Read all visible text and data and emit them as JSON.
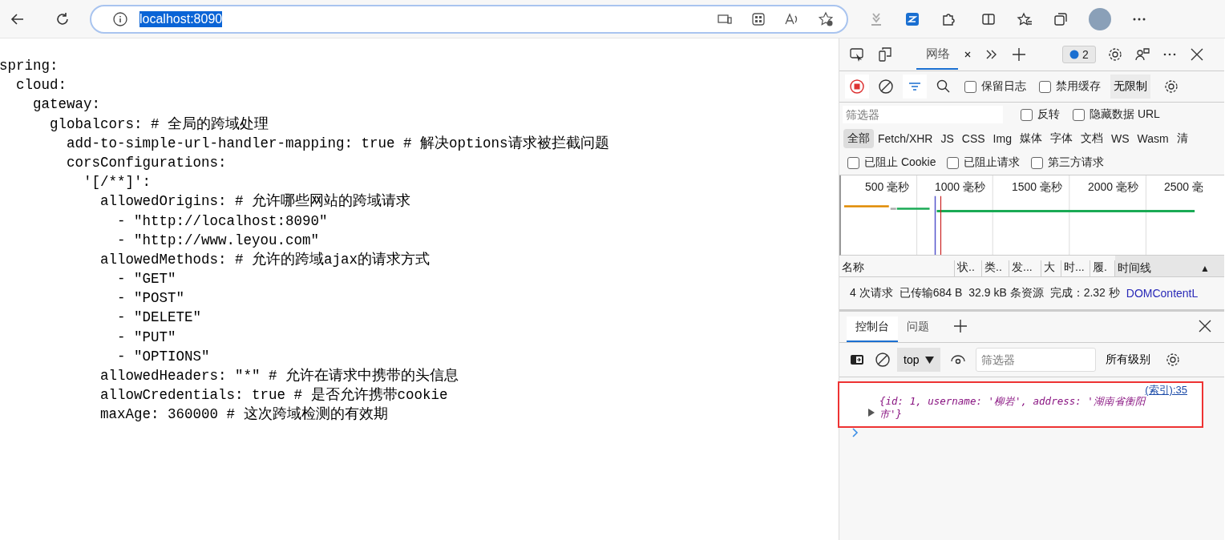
{
  "browser": {
    "address": "localhost:8090"
  },
  "code": [
    {
      "text": "spring:",
      "children": [
        {
          "text": "cloud:",
          "children": [
            {
              "text": "gateway:",
              "children": [
                {
                  "text": "globalcors: # 全局的跨域处理",
                  "children": [
                    {
                      "text": "add-to-simple-url-handler-mapping: true # 解决options请求被拦截问题"
                    },
                    {
                      "text": "corsConfigurations:",
                      "children": [
                        {
                          "text": "'[/**]':",
                          "children": [
                            {
                              "text": "allowedOrigins: # 允许哪些网站的跨域请求",
                              "children": [
                                {
                                  "text": "- \"http://localhost:8090\""
                                },
                                {
                                  "text": "- \"http://www.leyou.com\""
                                }
                              ]
                            },
                            {
                              "text": "allowedMethods: # 允许的跨域ajax的请求方式",
                              "children": [
                                {
                                  "text": "- \"GET\""
                                },
                                {
                                  "text": "- \"POST\""
                                },
                                {
                                  "text": "- \"DELETE\""
                                },
                                {
                                  "text": "- \"PUT\""
                                },
                                {
                                  "text": "- \"OPTIONS\""
                                }
                              ]
                            },
                            {
                              "text": "allowedHeaders: \"*\" # 允许在请求中携带的头信息"
                            },
                            {
                              "text": "allowCredentials: true # 是否允许携带cookie"
                            },
                            {
                              "text": "maxAge: 360000 # 这次跨域检测的有效期"
                            }
                          ]
                        }
                      ]
                    }
                  ]
                }
              ]
            }
          ]
        }
      ]
    }
  ],
  "devtools": {
    "tabs": [
      {
        "label": "网络",
        "selected": true
      }
    ],
    "issues_badge": "2",
    "network_toolbar": {
      "checkboxes": [
        {
          "label": "保留日志",
          "checked": false
        },
        {
          "label": "禁用缓存",
          "checked": false
        }
      ],
      "throttle": "无限制"
    },
    "filter": {
      "placeholder": "筛选器",
      "checkboxes": [
        {
          "label": "反转",
          "checked": false
        },
        {
          "label": "隐藏数据 URL",
          "checked": false
        }
      ]
    },
    "types": [
      {
        "label": "全部",
        "selected": true
      },
      {
        "label": "Fetch/XHR",
        "selected": false
      },
      {
        "label": "JS",
        "selected": false
      },
      {
        "label": "CSS",
        "selected": false
      },
      {
        "label": "Img",
        "selected": false
      },
      {
        "label": "媒体",
        "selected": false
      },
      {
        "label": "字体",
        "selected": false
      },
      {
        "label": "文档",
        "selected": false
      },
      {
        "label": "WS",
        "selected": false
      },
      {
        "label": "Wasm",
        "selected": false
      },
      {
        "label": "清",
        "selected": false
      }
    ],
    "block_checkboxes": [
      {
        "label": "已阻止 Cookie",
        "checked": false
      },
      {
        "label": "已阻止请求",
        "checked": false
      },
      {
        "label": "第三方请求",
        "checked": false
      }
    ],
    "timeline_ticks": [
      "500  毫秒",
      "1000  毫秒",
      "1500  毫秒",
      "2000  毫秒",
      "2500  毫"
    ],
    "columns": [
      "名称",
      "状..",
      "类..",
      "发...",
      "大",
      "时...",
      "履.",
      "时间线"
    ],
    "sort_arrow": "▲",
    "summary": [
      "4 次请求",
      "已传输684 B",
      "32.9 kB 条资源",
      "完成：2.32 秒"
    ],
    "summary_link": "DOMContentL",
    "drawer_tabs": [
      {
        "label": "控制台",
        "selected": true
      },
      {
        "label": "问题",
        "selected": false
      }
    ],
    "console": {
      "context": "top",
      "filter_placeholder": "筛选器",
      "levels": "所有级别",
      "source": "(索引):35",
      "message": "{id: 1, username: '柳岩', address: '湖南省衡阳市'}"
    }
  }
}
